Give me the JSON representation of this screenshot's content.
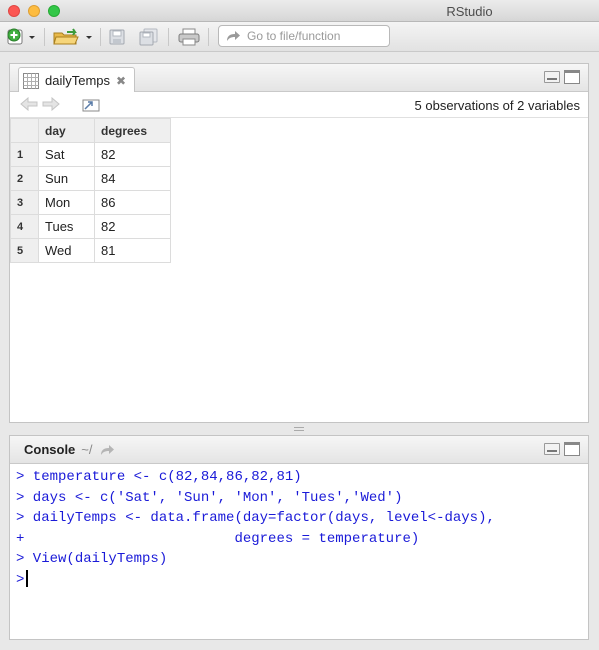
{
  "window": {
    "title": "RStudio"
  },
  "toolbar": {
    "goto_placeholder": "Go to file/function"
  },
  "data_viewer": {
    "tab_label": "dailyTemps",
    "summary": "5 observations of 2 variables",
    "columns": [
      "day",
      "degrees"
    ],
    "rows": [
      {
        "n": "1",
        "day": "Sat",
        "degrees": "82"
      },
      {
        "n": "2",
        "day": "Sun",
        "degrees": "84"
      },
      {
        "n": "3",
        "day": "Mon",
        "degrees": "86"
      },
      {
        "n": "4",
        "day": "Tues",
        "degrees": "82"
      },
      {
        "n": "5",
        "day": "Wed",
        "degrees": "81"
      }
    ]
  },
  "console": {
    "title": "Console",
    "path": "~/",
    "lines": [
      {
        "prompt": ">",
        "code": " temperature <- c(82,84,86,82,81)"
      },
      {
        "prompt": ">",
        "code": " days <- c('Sat', 'Sun', 'Mon', 'Tues','Wed')"
      },
      {
        "prompt": ">",
        "code": " dailyTemps <- data.frame(day=factor(days, level<-days),"
      },
      {
        "prompt": "+",
        "code": "                         degrees = temperature)"
      },
      {
        "prompt": ">",
        "code": " View(dailyTemps)"
      },
      {
        "prompt": ">",
        "code": " "
      }
    ]
  }
}
